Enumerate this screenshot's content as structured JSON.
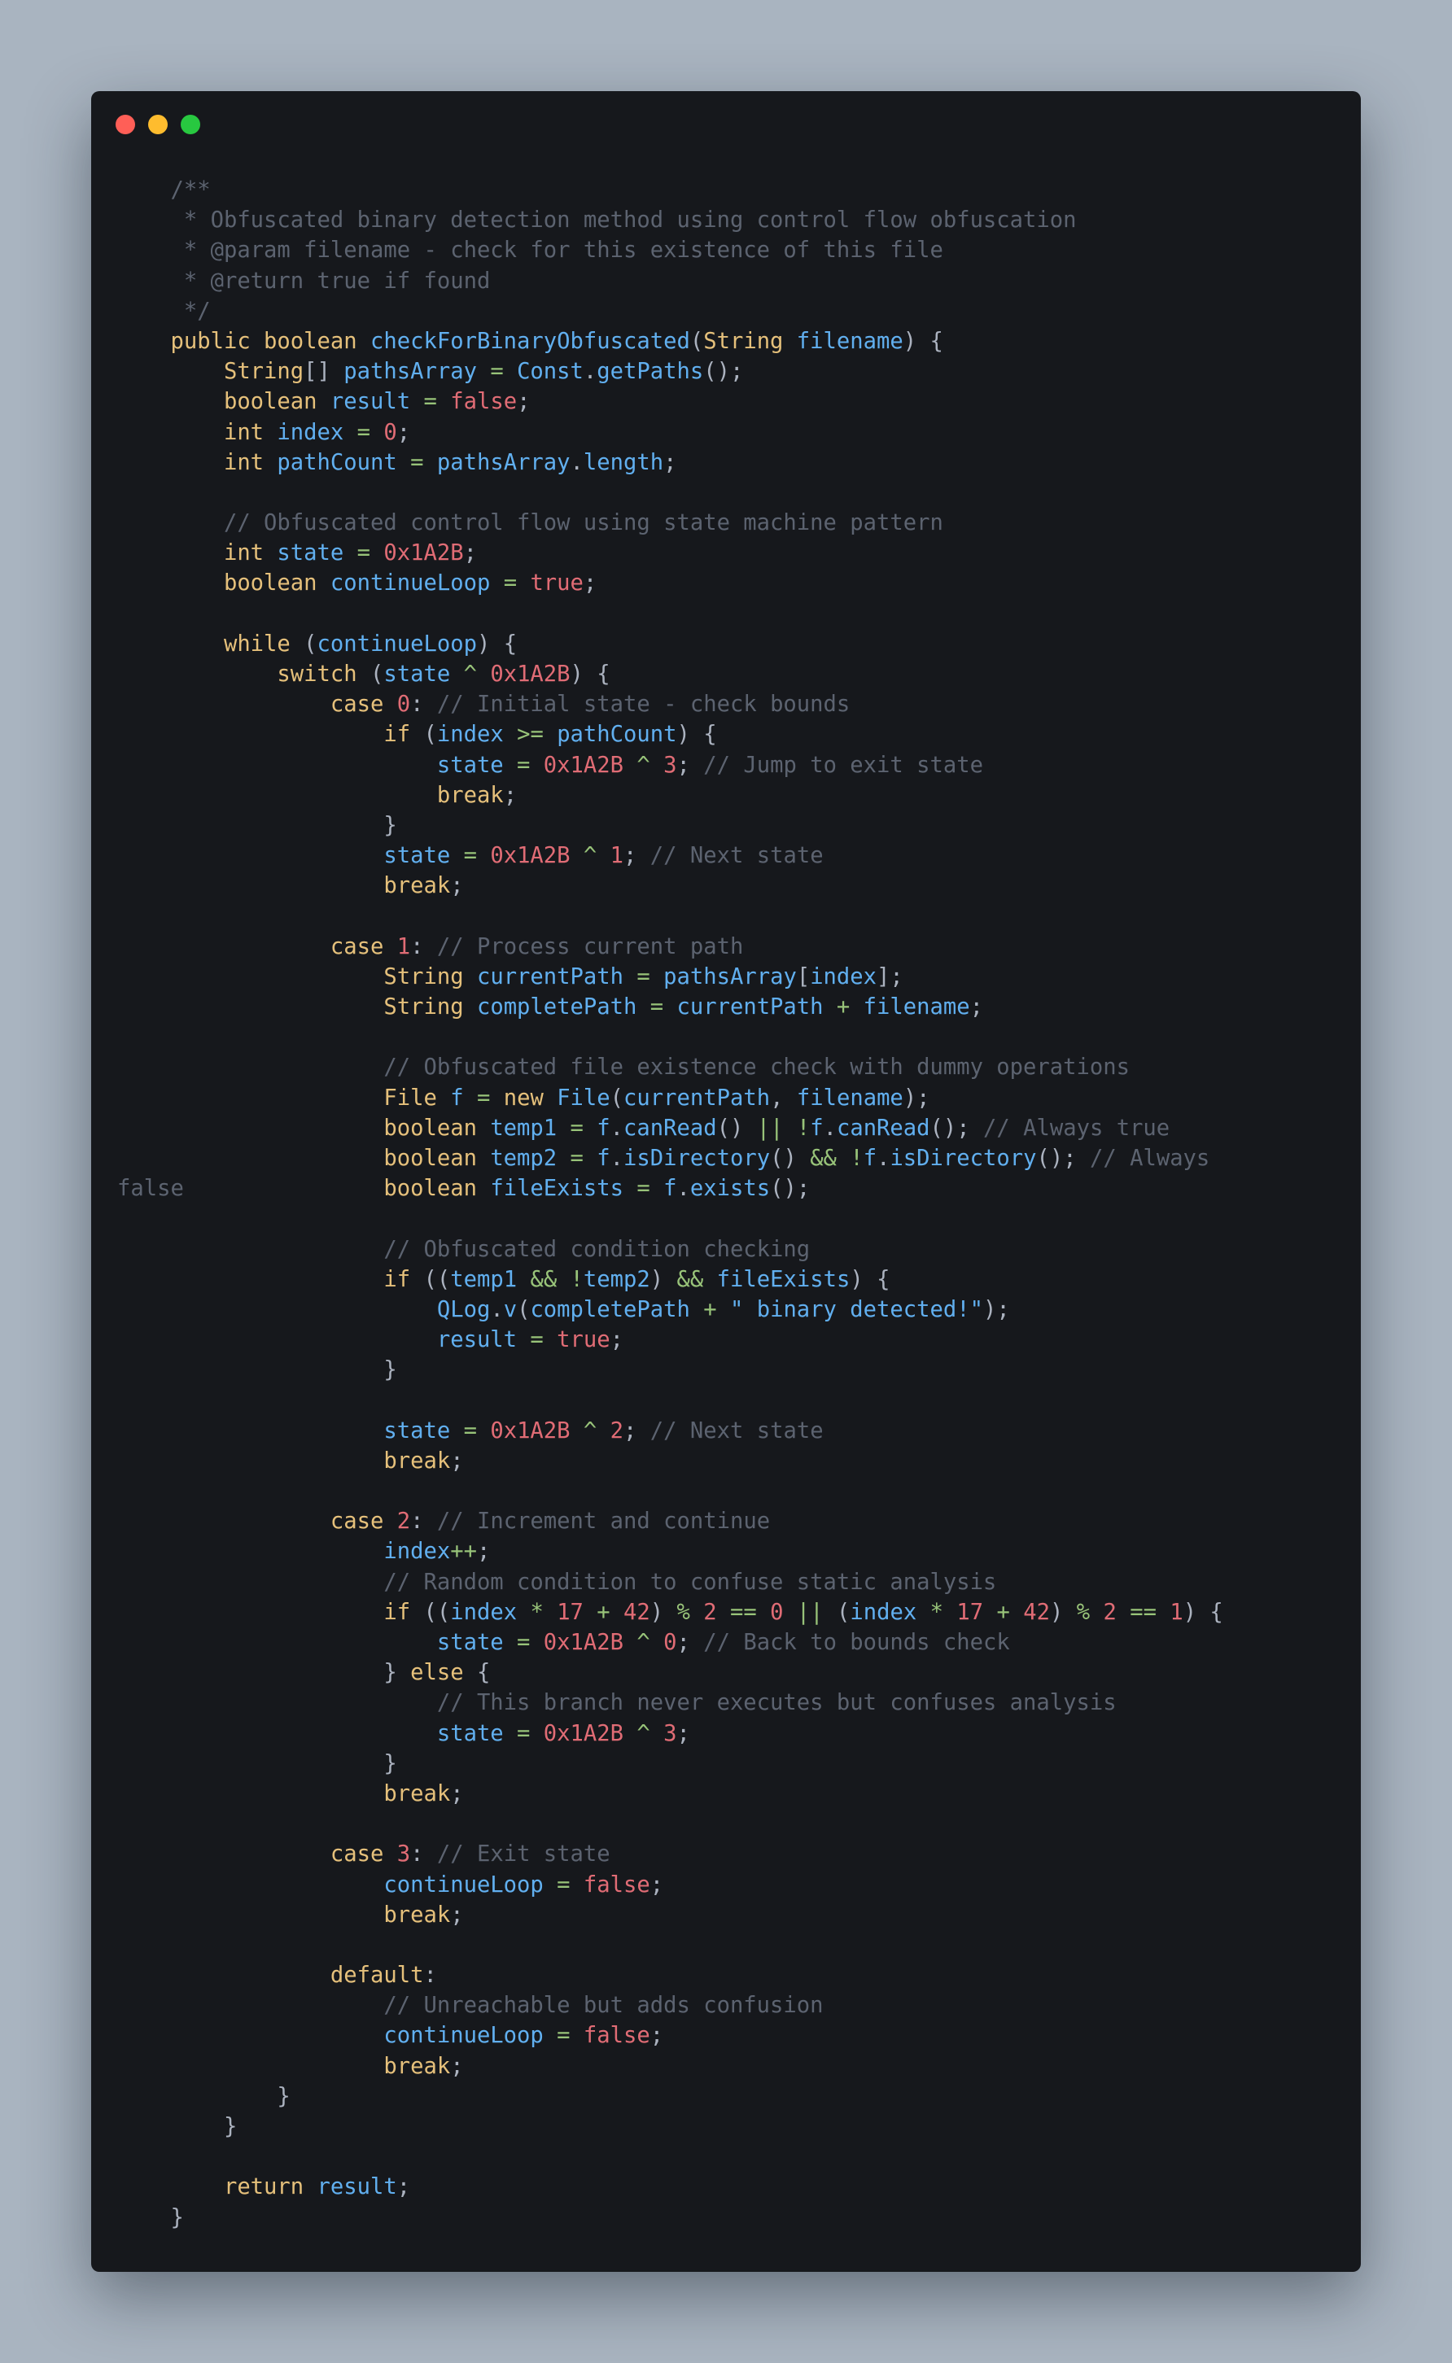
{
  "window": {
    "buttons": {
      "close": "#ff5f57",
      "minimize": "#febc2e",
      "zoom": "#28c840"
    },
    "background": "#16181c"
  },
  "colors": {
    "keyword": "#e5c07b",
    "identifier": "#61afef",
    "number": "#e06c75",
    "comment": "#5c6370",
    "operator": "#98c379",
    "plain": "#abb2bf"
  },
  "code": {
    "lines": [
      [
        [
          "c",
          "    /**"
        ]
      ],
      [
        [
          "c",
          "     * Obfuscated binary detection method using control flow obfuscation"
        ]
      ],
      [
        [
          "c",
          "     * @param filename - check for this existence of this file"
        ]
      ],
      [
        [
          "c",
          "     * @return true if found"
        ]
      ],
      [
        [
          "c",
          "     */"
        ]
      ],
      [
        [
          "k",
          "    public boolean "
        ],
        [
          "f",
          "checkForBinaryObfuscated"
        ],
        [
          "p",
          "("
        ],
        [
          "k",
          "String "
        ],
        [
          "f",
          "filename"
        ],
        [
          "p",
          ") {"
        ]
      ],
      [
        [
          "k",
          "        String"
        ],
        [
          "p",
          "[] "
        ],
        [
          "f",
          "pathsArray"
        ],
        [
          "s",
          " = "
        ],
        [
          "f",
          "Const"
        ],
        [
          "p",
          "."
        ],
        [
          "f",
          "getPaths"
        ],
        [
          "p",
          "();"
        ]
      ],
      [
        [
          "k",
          "        boolean "
        ],
        [
          "f",
          "result"
        ],
        [
          "s",
          " = "
        ],
        [
          "n",
          "false"
        ],
        [
          "p",
          ";"
        ]
      ],
      [
        [
          "k",
          "        int "
        ],
        [
          "f",
          "index"
        ],
        [
          "s",
          " = "
        ],
        [
          "n",
          "0"
        ],
        [
          "p",
          ";"
        ]
      ],
      [
        [
          "k",
          "        int "
        ],
        [
          "f",
          "pathCount"
        ],
        [
          "s",
          " = "
        ],
        [
          "f",
          "pathsArray"
        ],
        [
          "p",
          "."
        ],
        [
          "f",
          "length"
        ],
        [
          "p",
          ";"
        ]
      ],
      [
        [
          "p",
          ""
        ]
      ],
      [
        [
          "c",
          "        // Obfuscated control flow using state machine pattern"
        ]
      ],
      [
        [
          "k",
          "        int "
        ],
        [
          "f",
          "state"
        ],
        [
          "s",
          " = "
        ],
        [
          "n",
          "0x1A2B"
        ],
        [
          "p",
          ";"
        ]
      ],
      [
        [
          "k",
          "        boolean "
        ],
        [
          "f",
          "continueLoop"
        ],
        [
          "s",
          " = "
        ],
        [
          "n",
          "true"
        ],
        [
          "p",
          ";"
        ]
      ],
      [
        [
          "p",
          ""
        ]
      ],
      [
        [
          "k",
          "        while "
        ],
        [
          "p",
          "("
        ],
        [
          "f",
          "continueLoop"
        ],
        [
          "p",
          ") {"
        ]
      ],
      [
        [
          "k",
          "            switch "
        ],
        [
          "p",
          "("
        ],
        [
          "f",
          "state"
        ],
        [
          "s",
          " ^ "
        ],
        [
          "n",
          "0x1A2B"
        ],
        [
          "p",
          ") {"
        ]
      ],
      [
        [
          "k",
          "                case "
        ],
        [
          "n",
          "0"
        ],
        [
          "p",
          ": "
        ],
        [
          "c",
          "// Initial state - check bounds"
        ]
      ],
      [
        [
          "k",
          "                    if "
        ],
        [
          "p",
          "("
        ],
        [
          "f",
          "index"
        ],
        [
          "s",
          " >= "
        ],
        [
          "f",
          "pathCount"
        ],
        [
          "p",
          ") {"
        ]
      ],
      [
        [
          "f",
          "                        state"
        ],
        [
          "s",
          " = "
        ],
        [
          "n",
          "0x1A2B"
        ],
        [
          "s",
          " ^ "
        ],
        [
          "n",
          "3"
        ],
        [
          "p",
          "; "
        ],
        [
          "c",
          "// Jump to exit state"
        ]
      ],
      [
        [
          "k",
          "                        break"
        ],
        [
          "p",
          ";"
        ]
      ],
      [
        [
          "p",
          "                    }"
        ]
      ],
      [
        [
          "f",
          "                    state"
        ],
        [
          "s",
          " = "
        ],
        [
          "n",
          "0x1A2B"
        ],
        [
          "s",
          " ^ "
        ],
        [
          "n",
          "1"
        ],
        [
          "p",
          "; "
        ],
        [
          "c",
          "// Next state"
        ]
      ],
      [
        [
          "k",
          "                    break"
        ],
        [
          "p",
          ";"
        ]
      ],
      [
        [
          "p",
          ""
        ]
      ],
      [
        [
          "k",
          "                case "
        ],
        [
          "n",
          "1"
        ],
        [
          "p",
          ": "
        ],
        [
          "c",
          "// Process current path"
        ]
      ],
      [
        [
          "k",
          "                    String "
        ],
        [
          "f",
          "currentPath"
        ],
        [
          "s",
          " = "
        ],
        [
          "f",
          "pathsArray"
        ],
        [
          "p",
          "["
        ],
        [
          "f",
          "index"
        ],
        [
          "p",
          "];"
        ]
      ],
      [
        [
          "k",
          "                    String "
        ],
        [
          "f",
          "completePath"
        ],
        [
          "s",
          " = "
        ],
        [
          "f",
          "currentPath"
        ],
        [
          "s",
          " + "
        ],
        [
          "f",
          "filename"
        ],
        [
          "p",
          ";"
        ]
      ],
      [
        [
          "p",
          ""
        ]
      ],
      [
        [
          "c",
          "                    // Obfuscated file existence check with dummy operations"
        ]
      ],
      [
        [
          "k",
          "                    File "
        ],
        [
          "f",
          "f"
        ],
        [
          "s",
          " = "
        ],
        [
          "k",
          "new "
        ],
        [
          "f",
          "File"
        ],
        [
          "p",
          "("
        ],
        [
          "f",
          "currentPath"
        ],
        [
          "p",
          ", "
        ],
        [
          "f",
          "filename"
        ],
        [
          "p",
          ");"
        ]
      ],
      [
        [
          "k",
          "                    boolean "
        ],
        [
          "f",
          "temp1"
        ],
        [
          "s",
          " = "
        ],
        [
          "f",
          "f"
        ],
        [
          "p",
          "."
        ],
        [
          "f",
          "canRead"
        ],
        [
          "p",
          "() "
        ],
        [
          "s",
          "||"
        ],
        [
          "p",
          " "
        ],
        [
          "s",
          "!"
        ],
        [
          "f",
          "f"
        ],
        [
          "p",
          "."
        ],
        [
          "f",
          "canRead"
        ],
        [
          "p",
          "(); "
        ],
        [
          "c",
          "// Always true"
        ]
      ],
      [
        [
          "k",
          "                    boolean "
        ],
        [
          "f",
          "temp2"
        ],
        [
          "s",
          " = "
        ],
        [
          "f",
          "f"
        ],
        [
          "p",
          "."
        ],
        [
          "f",
          "isDirectory"
        ],
        [
          "p",
          "() "
        ],
        [
          "s",
          "&&"
        ],
        [
          "p",
          " "
        ],
        [
          "s",
          "!"
        ],
        [
          "f",
          "f"
        ],
        [
          "p",
          "."
        ],
        [
          "f",
          "isDirectory"
        ],
        [
          "p",
          "(); "
        ],
        [
          "c",
          "// Always"
        ]
      ],
      [
        [
          "c",
          "false"
        ],
        [
          "p",
          "               "
        ],
        [
          "k",
          "boolean "
        ],
        [
          "f",
          "fileExists"
        ],
        [
          "s",
          " = "
        ],
        [
          "f",
          "f"
        ],
        [
          "p",
          "."
        ],
        [
          "f",
          "exists"
        ],
        [
          "p",
          "();"
        ]
      ],
      [
        [
          "p",
          ""
        ]
      ],
      [
        [
          "c",
          "                    // Obfuscated condition checking"
        ]
      ],
      [
        [
          "k",
          "                    if "
        ],
        [
          "p",
          "(("
        ],
        [
          "f",
          "temp1"
        ],
        [
          "s",
          " && !"
        ],
        [
          "f",
          "temp2"
        ],
        [
          "p",
          ") "
        ],
        [
          "s",
          "&&"
        ],
        [
          "p",
          " "
        ],
        [
          "f",
          "fileExists"
        ],
        [
          "p",
          ") {"
        ]
      ],
      [
        [
          "f",
          "                        QLog"
        ],
        [
          "p",
          "."
        ],
        [
          "f",
          "v"
        ],
        [
          "p",
          "("
        ],
        [
          "f",
          "completePath"
        ],
        [
          "s",
          " + "
        ],
        [
          "f",
          "\" binary detected!\""
        ],
        [
          "p",
          ");"
        ]
      ],
      [
        [
          "f",
          "                        result"
        ],
        [
          "s",
          " = "
        ],
        [
          "n",
          "true"
        ],
        [
          "p",
          ";"
        ]
      ],
      [
        [
          "p",
          "                    }"
        ]
      ],
      [
        [
          "p",
          ""
        ]
      ],
      [
        [
          "f",
          "                    state"
        ],
        [
          "s",
          " = "
        ],
        [
          "n",
          "0x1A2B"
        ],
        [
          "s",
          " ^ "
        ],
        [
          "n",
          "2"
        ],
        [
          "p",
          "; "
        ],
        [
          "c",
          "// Next state"
        ]
      ],
      [
        [
          "k",
          "                    break"
        ],
        [
          "p",
          ";"
        ]
      ],
      [
        [
          "p",
          ""
        ]
      ],
      [
        [
          "k",
          "                case "
        ],
        [
          "n",
          "2"
        ],
        [
          "p",
          ": "
        ],
        [
          "c",
          "// Increment and continue"
        ]
      ],
      [
        [
          "f",
          "                    index"
        ],
        [
          "s",
          "++"
        ],
        [
          "p",
          ";"
        ]
      ],
      [
        [
          "c",
          "                    // Random condition to confuse static analysis"
        ]
      ],
      [
        [
          "k",
          "                    if "
        ],
        [
          "p",
          "(("
        ],
        [
          "f",
          "index"
        ],
        [
          "s",
          " * "
        ],
        [
          "n",
          "17"
        ],
        [
          "s",
          " + "
        ],
        [
          "n",
          "42"
        ],
        [
          "p",
          ") "
        ],
        [
          "s",
          "% "
        ],
        [
          "n",
          "2"
        ],
        [
          "s",
          " == "
        ],
        [
          "n",
          "0"
        ],
        [
          "s",
          " || "
        ],
        [
          "p",
          "("
        ],
        [
          "f",
          "index"
        ],
        [
          "s",
          " * "
        ],
        [
          "n",
          "17"
        ],
        [
          "s",
          " + "
        ],
        [
          "n",
          "42"
        ],
        [
          "p",
          ") "
        ],
        [
          "s",
          "% "
        ],
        [
          "n",
          "2"
        ],
        [
          "s",
          " == "
        ],
        [
          "n",
          "1"
        ],
        [
          "p",
          ") {"
        ]
      ],
      [
        [
          "f",
          "                        state"
        ],
        [
          "s",
          " = "
        ],
        [
          "n",
          "0x1A2B"
        ],
        [
          "s",
          " ^ "
        ],
        [
          "n",
          "0"
        ],
        [
          "p",
          "; "
        ],
        [
          "c",
          "// Back to bounds check"
        ]
      ],
      [
        [
          "p",
          "                    } "
        ],
        [
          "k",
          "else"
        ],
        [
          "p",
          " {"
        ]
      ],
      [
        [
          "c",
          "                        // This branch never executes but confuses analysis"
        ]
      ],
      [
        [
          "f",
          "                        state"
        ],
        [
          "s",
          " = "
        ],
        [
          "n",
          "0x1A2B"
        ],
        [
          "s",
          " ^ "
        ],
        [
          "n",
          "3"
        ],
        [
          "p",
          ";"
        ]
      ],
      [
        [
          "p",
          "                    }"
        ]
      ],
      [
        [
          "k",
          "                    break"
        ],
        [
          "p",
          ";"
        ]
      ],
      [
        [
          "p",
          ""
        ]
      ],
      [
        [
          "k",
          "                case "
        ],
        [
          "n",
          "3"
        ],
        [
          "p",
          ": "
        ],
        [
          "c",
          "// Exit state"
        ]
      ],
      [
        [
          "f",
          "                    continueLoop"
        ],
        [
          "s",
          " = "
        ],
        [
          "n",
          "false"
        ],
        [
          "p",
          ";"
        ]
      ],
      [
        [
          "k",
          "                    break"
        ],
        [
          "p",
          ";"
        ]
      ],
      [
        [
          "p",
          ""
        ]
      ],
      [
        [
          "k",
          "                default"
        ],
        [
          "p",
          ":"
        ]
      ],
      [
        [
          "c",
          "                    // Unreachable but adds confusion"
        ]
      ],
      [
        [
          "f",
          "                    continueLoop"
        ],
        [
          "s",
          " = "
        ],
        [
          "n",
          "false"
        ],
        [
          "p",
          ";"
        ]
      ],
      [
        [
          "k",
          "                    break"
        ],
        [
          "p",
          ";"
        ]
      ],
      [
        [
          "p",
          "            }"
        ]
      ],
      [
        [
          "p",
          "        }"
        ]
      ],
      [
        [
          "p",
          ""
        ]
      ],
      [
        [
          "k",
          "        return "
        ],
        [
          "f",
          "result"
        ],
        [
          "p",
          ";"
        ]
      ],
      [
        [
          "p",
          "    }"
        ]
      ]
    ]
  }
}
